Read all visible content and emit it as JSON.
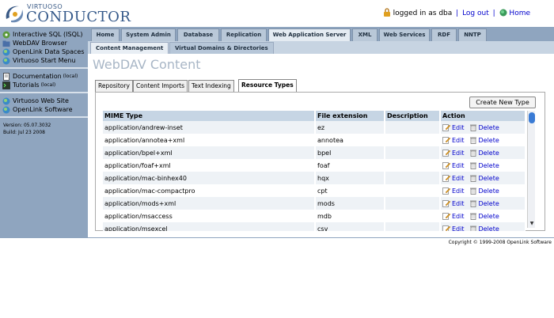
{
  "header": {
    "logo_small": "VIRTUOSO",
    "logo_big": "CONDUCTOR",
    "logged_in_text": "logged in as dba",
    "logout_label": "Log out",
    "home_label": "Home",
    "separator": "|"
  },
  "sidebar": {
    "group1": [
      {
        "label": "Interactive SQL (ISQL)",
        "icon": "gear-icon"
      },
      {
        "label": "WebDAV Browser",
        "icon": "folder-icon"
      },
      {
        "label": "OpenLink Data Spaces",
        "icon": "globe-icon"
      },
      {
        "label": "Virtuoso Start Menu",
        "icon": "globe-icon"
      }
    ],
    "group2": [
      {
        "label": "Documentation",
        "sub": "(local)",
        "icon": "document-icon"
      },
      {
        "label": "Tutorials",
        "sub": "(local)",
        "icon": "terminal-icon"
      }
    ],
    "group3": [
      {
        "label": "Virtuoso Web Site",
        "icon": "globe-icon"
      },
      {
        "label": "OpenLink Software",
        "icon": "globe-icon"
      }
    ],
    "version": "Version: 05.07.3032",
    "build": "Build: Jul 23 2008"
  },
  "main_tabs": [
    "Home",
    "System Admin",
    "Database",
    "Replication",
    "Web Application Server",
    "XML",
    "Web Services",
    "RDF",
    "NNTP"
  ],
  "sub_tabs": [
    "Content Management",
    "Virtual Domains & Directories"
  ],
  "page_title": "WebDAV Content",
  "inner_tabs": [
    "Repository",
    "Content Imports",
    "Text Indexing",
    "Resource Types"
  ],
  "new_button": "Create New Type",
  "table": {
    "headers": [
      "MIME Type",
      "File extension",
      "Description",
      "Action"
    ],
    "edit_label": "Edit",
    "delete_label": "Delete",
    "rows": [
      {
        "mime": "application/andrew-inset",
        "ext": "ez",
        "desc": ""
      },
      {
        "mime": "application/annotea+xml",
        "ext": "annotea",
        "desc": ""
      },
      {
        "mime": "application/bpel+xml",
        "ext": "bpel",
        "desc": ""
      },
      {
        "mime": "application/foaf+xml",
        "ext": "foaf",
        "desc": ""
      },
      {
        "mime": "application/mac-binhex40",
        "ext": "hqx",
        "desc": ""
      },
      {
        "mime": "application/mac-compactpro",
        "ext": "cpt",
        "desc": ""
      },
      {
        "mime": "application/mods+xml",
        "ext": "mods",
        "desc": ""
      },
      {
        "mime": "application/msaccess",
        "ext": "mdb",
        "desc": ""
      },
      {
        "mime": "application/msexcel",
        "ext": "csv",
        "desc": ""
      }
    ]
  },
  "footer": {
    "copyright": "Copyright © 1999-2008 OpenLink Software"
  },
  "colors": {
    "sidebar_bg": "#8fa5bf",
    "tab_bg": "#b9c8d8",
    "header_row_bg": "#c6d5e4",
    "link": "#0000cc",
    "title": "#a8b6c6"
  }
}
